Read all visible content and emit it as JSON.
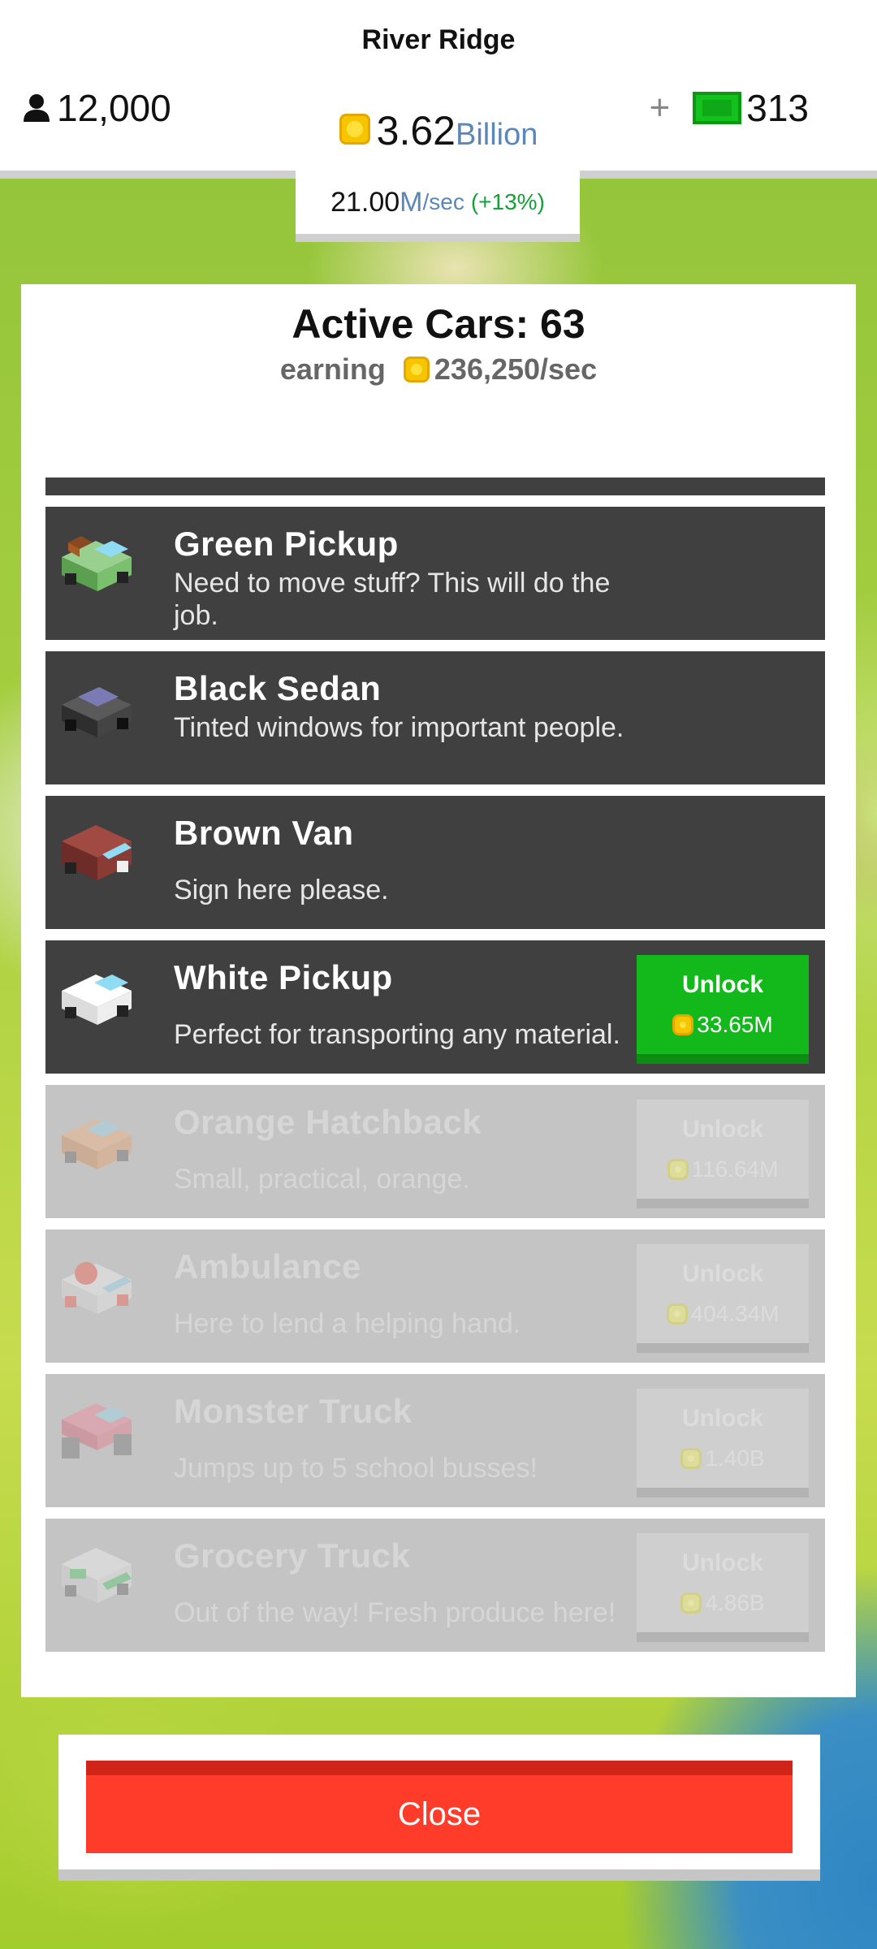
{
  "header": {
    "city_name": "River Ridge",
    "population": "12,000",
    "coins_value": "3.62",
    "coins_unit": "Billion",
    "cash": "313",
    "rate_value": "21.00",
    "rate_unit": "M",
    "rate_per": "/sec",
    "rate_pct": "(+13%)"
  },
  "panel": {
    "title": "Active Cars: 63",
    "earning_label": "earning",
    "earning_value": "236,250/sec"
  },
  "cars": [
    {
      "name": "Green Pickup",
      "desc": "Need to move stuff? This will do the job.",
      "icon": "green-pickup-icon",
      "color": "#6fb36a"
    },
    {
      "name": "Black Sedan",
      "desc": "Tinted windows for important people.",
      "icon": "black-sedan-icon",
      "color": "#3c3c3c"
    },
    {
      "name": "Brown Van",
      "desc": "Sign here please.",
      "icon": "brown-van-icon",
      "color": "#8a3b34"
    },
    {
      "name": "White Pickup",
      "desc": "Perfect for transporting any material.",
      "icon": "white-pickup-icon",
      "unlock_label": "Unlock",
      "price": "33.65M"
    },
    {
      "name": "Orange Hatchback",
      "desc": "Small, practical, orange.",
      "icon": "orange-hatchback-icon",
      "unlock_label": "Unlock",
      "price": "116.64M"
    },
    {
      "name": "Ambulance",
      "desc": "Here to lend a helping hand.",
      "icon": "ambulance-icon",
      "unlock_label": "Unlock",
      "price": "404.34M"
    },
    {
      "name": "Monster Truck",
      "desc": "Jumps up to 5 school busses!",
      "icon": "monster-truck-icon",
      "unlock_label": "Unlock",
      "price": "1.40B"
    },
    {
      "name": "Grocery Truck",
      "desc": "Out of the way! Fresh produce here!",
      "icon": "grocery-truck-icon",
      "unlock_label": "Unlock",
      "price": "4.86B"
    }
  ],
  "close_label": "Close",
  "colors": {
    "unlock_green": "#13b81a",
    "close_red": "#ff3c2a",
    "row_dark": "#404040",
    "row_locked": "#c4c4c4",
    "coin_gold": "#f7c500"
  }
}
